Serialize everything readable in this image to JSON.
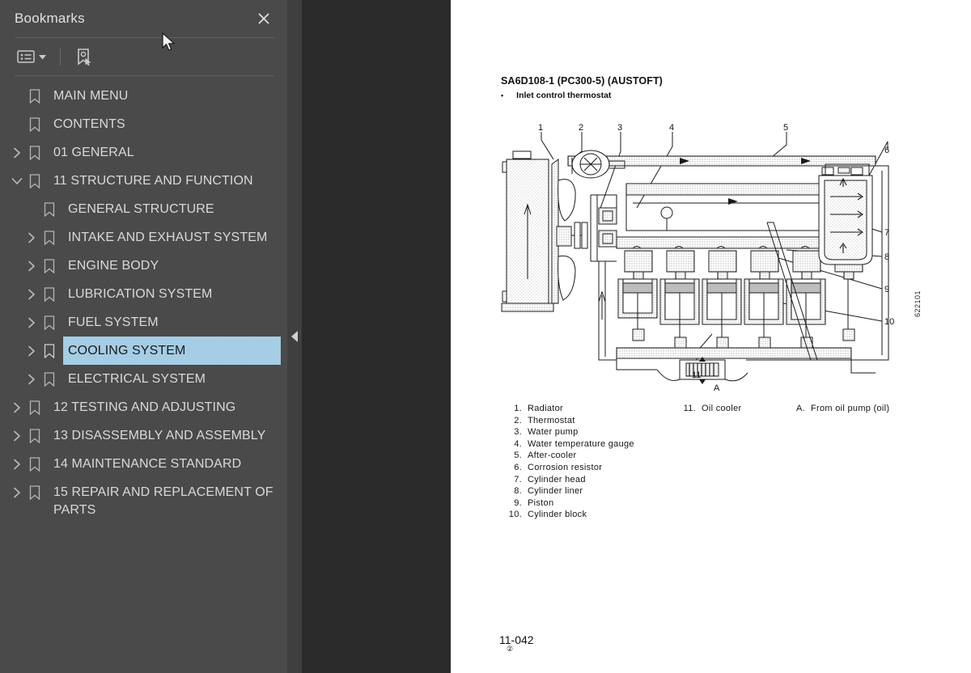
{
  "sidebar": {
    "title": "Bookmarks",
    "close_icon": "close-icon",
    "toolbar": {
      "options_label": "list-options-icon",
      "caret_label": "chevron-down-icon",
      "new_bookmark_label": "bookmark-pointer-icon"
    },
    "selection_color": "#a5cde5",
    "items": [
      {
        "label": "MAIN MENU",
        "level": 0,
        "twisty": "none"
      },
      {
        "label": "CONTENTS",
        "level": 0,
        "twisty": "none"
      },
      {
        "label": "01 GENERAL",
        "level": 0,
        "twisty": "collapsed"
      },
      {
        "label": "11 STRUCTURE AND FUNCTION",
        "level": 0,
        "twisty": "expanded"
      },
      {
        "label": "GENERAL STRUCTURE",
        "level": 1,
        "twisty": "none"
      },
      {
        "label": "INTAKE AND EXHAUST SYSTEM",
        "level": 1,
        "twisty": "collapsed"
      },
      {
        "label": "ENGINE BODY",
        "level": 1,
        "twisty": "collapsed"
      },
      {
        "label": "LUBRICATION SYSTEM",
        "level": 1,
        "twisty": "collapsed"
      },
      {
        "label": "FUEL SYSTEM",
        "level": 1,
        "twisty": "collapsed"
      },
      {
        "label": "COOLING SYSTEM",
        "level": 1,
        "twisty": "collapsed",
        "selected": true
      },
      {
        "label": "ELECTRICAL SYSTEM",
        "level": 1,
        "twisty": "collapsed"
      },
      {
        "label": "12 TESTING AND ADJUSTING",
        "level": 0,
        "twisty": "collapsed"
      },
      {
        "label": "13 DISASSEMBLY AND ASSEMBLY",
        "level": 0,
        "twisty": "collapsed"
      },
      {
        "label": "14 MAINTENANCE STANDARD",
        "level": 0,
        "twisty": "collapsed"
      },
      {
        "label": "15 REPAIR AND REPLACEMENT OF PARTS",
        "level": 0,
        "twisty": "collapsed"
      }
    ]
  },
  "divider": {
    "handle_icon": "collapse-left-triangle-icon"
  },
  "document": {
    "title": "SA6D108-1 (PC300-5) (AUSTOFT)",
    "bullet": "•",
    "subtitle": "Inlet control thermostat",
    "figure_code": "622101",
    "callouts": [
      "1",
      "2",
      "3",
      "4",
      "5",
      "6",
      "7",
      "8",
      "9",
      "10",
      "11",
      "A"
    ],
    "legend": {
      "column_1": [
        {
          "num": "1.",
          "text": "Radiator"
        },
        {
          "num": "2.",
          "text": "Thermostat"
        },
        {
          "num": "3.",
          "text": "Water pump"
        },
        {
          "num": "4.",
          "text": "Water temperature gauge"
        },
        {
          "num": "5.",
          "text": "After-cooler"
        },
        {
          "num": "6.",
          "text": "Corrosion resistor"
        },
        {
          "num": "7.",
          "text": "Cylinder head"
        },
        {
          "num": "8.",
          "text": "Cylinder liner"
        },
        {
          "num": "9.",
          "text": "Piston"
        },
        {
          "num": "10.",
          "text": "Cylinder block"
        }
      ],
      "column_2": [
        {
          "num": "11.",
          "text": "Oil cooler"
        }
      ],
      "column_3": [
        {
          "num": "A.",
          "text": "From oil pump (oil)"
        }
      ]
    },
    "page_number": "11-042",
    "page_number_sub": "②"
  }
}
